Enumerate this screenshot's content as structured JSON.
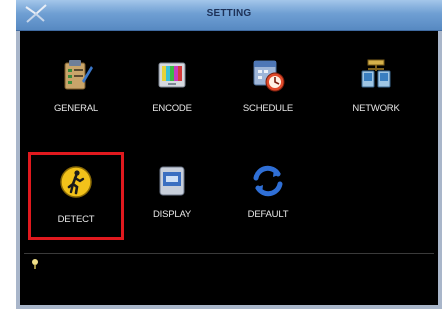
{
  "window": {
    "title": "SETTING"
  },
  "menu": {
    "items": [
      {
        "label": "GENERAL",
        "icon": "general-icon",
        "selected": false
      },
      {
        "label": "ENCODE",
        "icon": "encode-icon",
        "selected": false
      },
      {
        "label": "SCHEDULE",
        "icon": "schedule-icon",
        "selected": false
      },
      {
        "label": "NETWORK",
        "icon": "network-icon",
        "selected": false
      },
      {
        "label": "DETECT",
        "icon": "detect-icon",
        "selected": true
      },
      {
        "label": "DISPLAY",
        "icon": "display-icon",
        "selected": false
      },
      {
        "label": "DEFAULT",
        "icon": "default-icon",
        "selected": false
      }
    ]
  },
  "colors": {
    "titlebar": "#6f9fd3",
    "panel": "#000000",
    "selection": "#e0191e",
    "frame": "#a9b6ca"
  },
  "status": {
    "icon": "pin-icon"
  }
}
